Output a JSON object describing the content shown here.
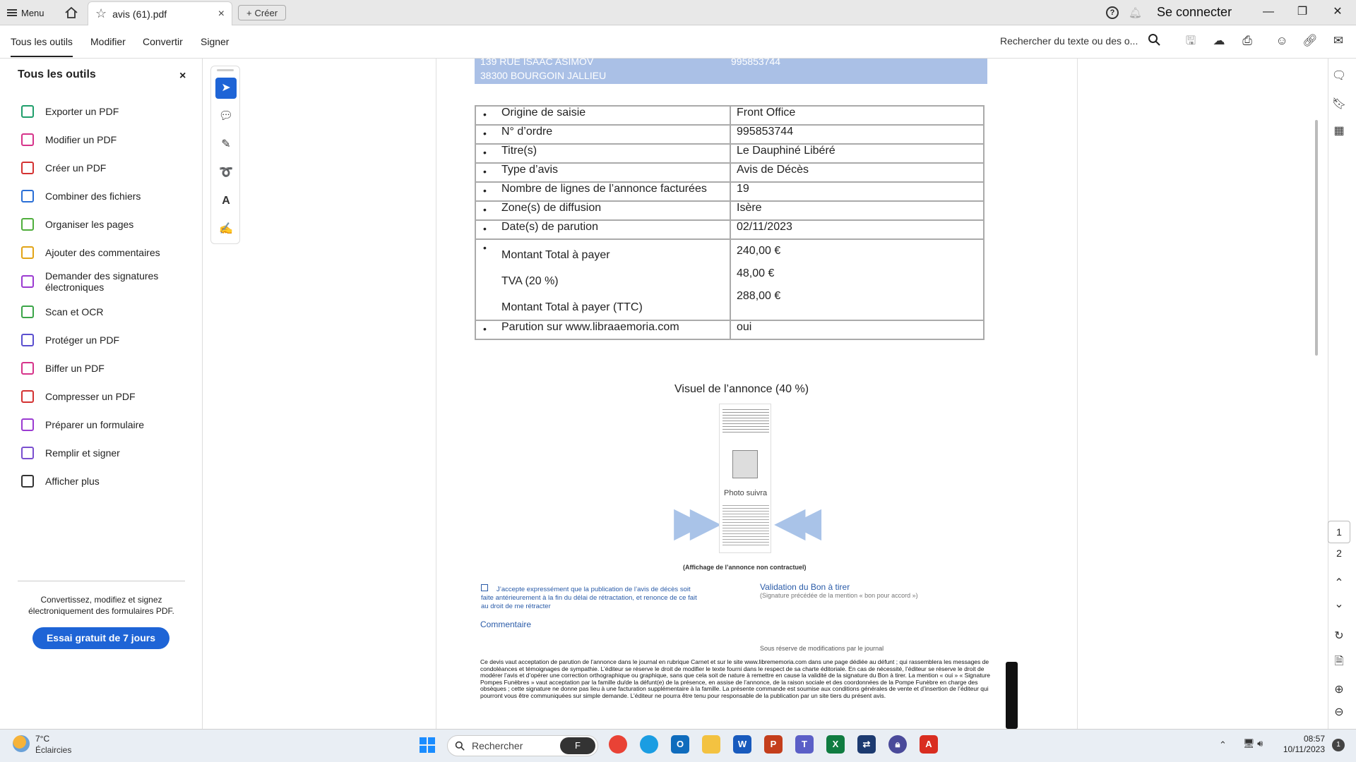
{
  "titlebar": {
    "menu_label": "Menu",
    "tab_title": "avis (61).pdf",
    "tab_close": "×",
    "create_label": "Créer",
    "login_label": "Se connecter"
  },
  "menubar": {
    "tabs": [
      "Tous les outils",
      "Modifier",
      "Convertir",
      "Signer"
    ],
    "search_label": "Rechercher du texte ou des o..."
  },
  "tools_panel": {
    "title": "Tous les outils",
    "close": "×",
    "items": [
      {
        "label": "Exporter un PDF",
        "color": "#1f9e6b"
      },
      {
        "label": "Modifier un PDF",
        "color": "#d6338a"
      },
      {
        "label": "Créer un PDF",
        "color": "#d43232"
      },
      {
        "label": "Combiner des fichiers",
        "color": "#2a6fd6"
      },
      {
        "label": "Organiser les pages",
        "color": "#4fae3c"
      },
      {
        "label": "Ajouter des commentaires",
        "color": "#e2a417"
      },
      {
        "label": "Demander des signatures",
        "label2": "électroniques",
        "color": "#9b3bd1"
      },
      {
        "label": "Scan et OCR",
        "color": "#3ba548"
      },
      {
        "label": "Protéger un PDF",
        "color": "#5a4fcf"
      },
      {
        "label": "Biffer un PDF",
        "color": "#d6338a"
      },
      {
        "label": "Compresser un PDF",
        "color": "#d43232"
      },
      {
        "label": "Préparer un formulaire",
        "color": "#9b3bd1"
      },
      {
        "label": "Remplir et signer",
        "color": "#7a4fcf"
      },
      {
        "label": "Afficher plus",
        "color": "#333333"
      }
    ],
    "promo_text": "Convertissez, modifiez et signez électroniquement des formulaires PDF.",
    "trial_button": "Essai gratuit de 7 jours"
  },
  "document": {
    "addr_line1": "139 RUE ISAAC ASIMOV",
    "addr_line2": "38300 BOURGOIN JALLIEU",
    "addr_right": "995853744",
    "rows": [
      {
        "key": "Origine de saisie",
        "value": "Front Office"
      },
      {
        "key": "N° d’ordre",
        "value": "995853744"
      },
      {
        "key": "Titre(s)",
        "value": "Le Dauphiné Libéré"
      },
      {
        "key": "Type d’avis",
        "value": "Avis de Décès"
      },
      {
        "key": "Nombre de lignes de l’annonce facturées",
        "value": "19"
      },
      {
        "key": "Zone(s) de diffusion",
        "value": "Isère"
      },
      {
        "key": "Date(s) de parution",
        "value": "02/11/2023"
      }
    ],
    "totals": {
      "k1": "Montant Total à payer",
      "v1": "240,00 €",
      "k2": "TVA (20 %)",
      "v2": "48,00 €",
      "k3": "Montant Total à payer (TTC)",
      "v3": "288,00 €"
    },
    "parution_key": "Parution sur www.librამemoria.com",
    "parution_value": "oui",
    "visuel_title": "Visuel de l’annonce (40 %)",
    "preview_photo_text": "Photo suivra",
    "affichage": "(Affichage de l’annonce non contractuel)",
    "consent": "J’accepte expressément que la publication de l’avis de décès soit faite antérieurement à la fin du délai de rétractation, et renonce de ce fait au droit de me rétracter",
    "validation": "Validation du Bon à tirer",
    "validation_sub": "(Signature précédée de la mention « bon pour accord »)",
    "commentaire": "Commentaire",
    "reserve": "Sous réserve de modifications par le journal",
    "legal": "Ce devis vaut acceptation de parution de l’annonce dans le journal en rubrique Carnet et sur le site www.librememoria.com dans une page dédiée au défunt ; qui rassemblera les messages de condoléances et témoignages de sympathie. L’éditeur se réserve le droit de modifier le texte fourni dans le respect de sa charte éditoriale. En cas de nécessité, l’éditeur se réserve le droit de modérer l’avis et d’opérer une correction orthographique ou graphique, sans que cela soit de nature à remettre en cause la validité de la signature du Bon à tirer. La mention « oui » « Signature Pompes Funèbres » vaut acceptation par la famille du/de la défunt(e) de la présence, en assise de l’annonce, de la raison sociale et des coordonnées de la Pompe Funèbre en charge des obsèques ; cette signature ne donne pas lieu à une facturation supplémentaire à la famille. La présente commande est soumise aux conditions générales de vente et d’insertion de l’éditeur qui pourront vous être communiquées sur simple demande. L’éditeur ne pourra être tenu pour responsable de la publication par un site tiers du présent avis."
  },
  "pages": {
    "current": "1",
    "next": "2"
  },
  "taskbar": {
    "temp": "7°C",
    "weather": "Éclaircies",
    "search_placeholder": "Rechercher",
    "time": "08:57",
    "date": "10/11/2023",
    "notifications": "1"
  }
}
